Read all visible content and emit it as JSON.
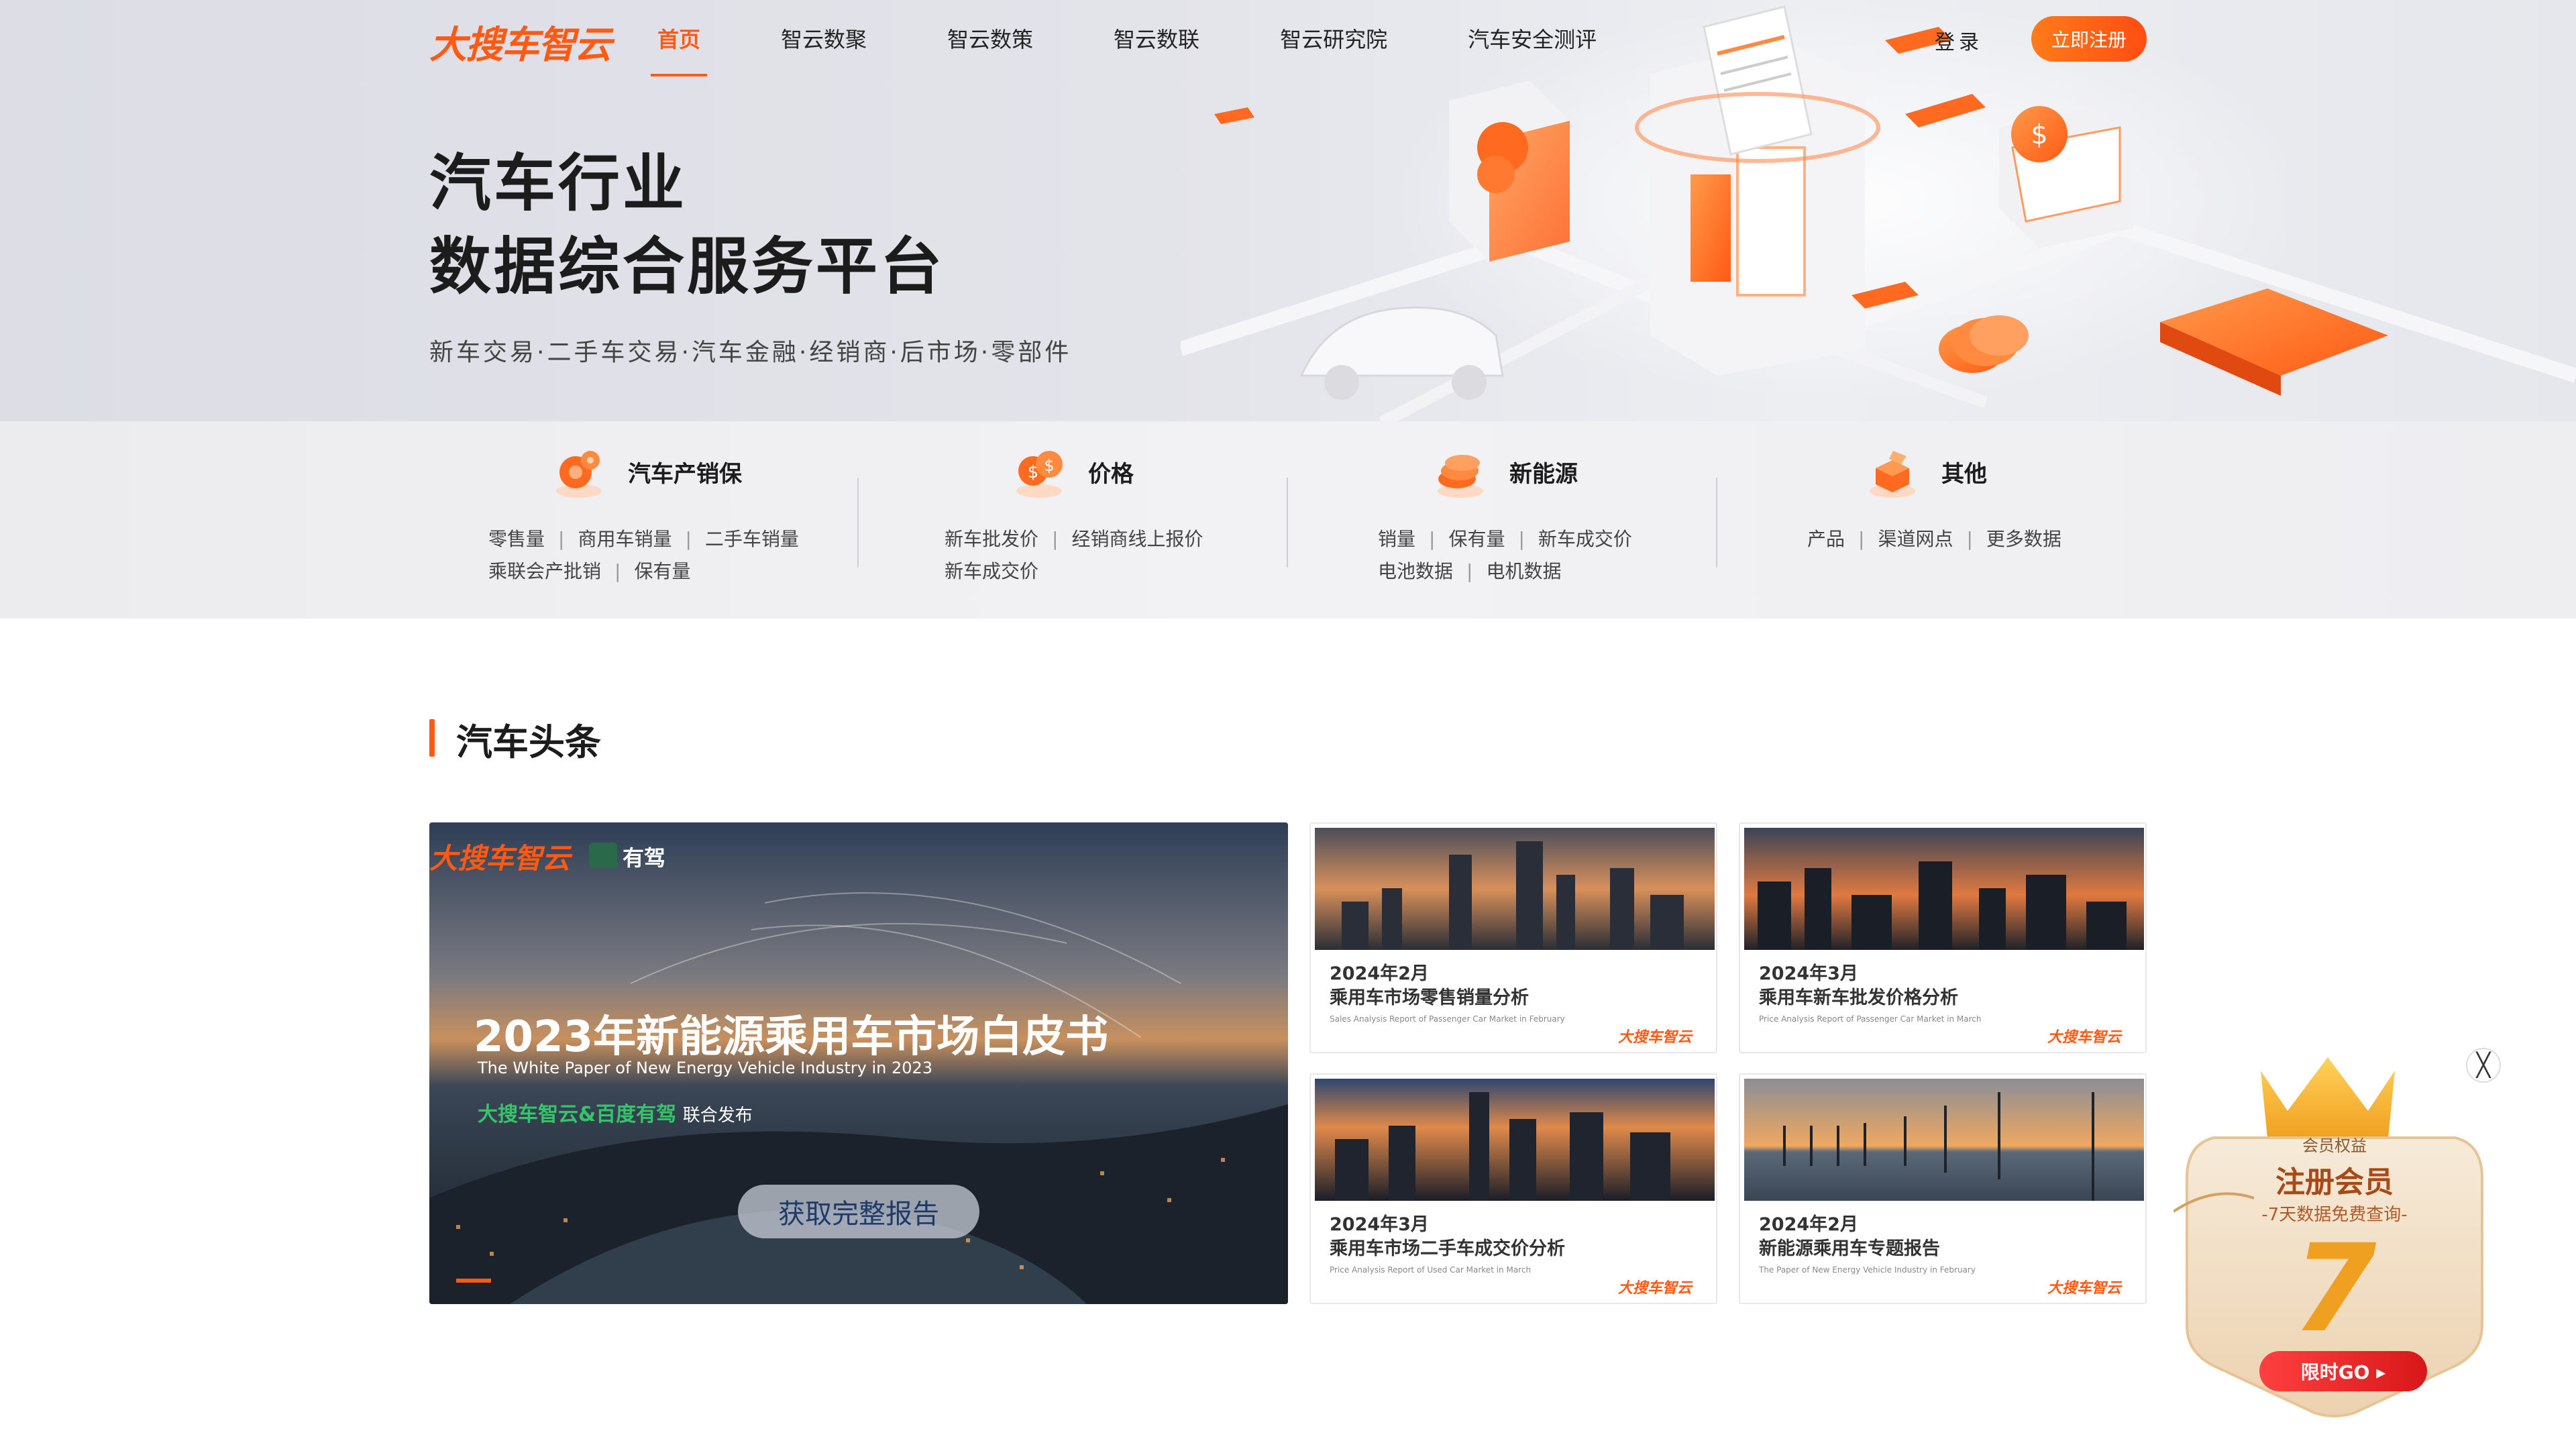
{
  "header": {
    "logo": "大搜车智云",
    "nav": [
      "首页",
      "智云数聚",
      "智云数策",
      "智云数联",
      "智云研究院",
      "汽车安全测评"
    ],
    "login": "登录",
    "register": "立即注册"
  },
  "hero": {
    "title_line1": "汽车行业",
    "title_line2": "数据综合服务平台",
    "subtitle": "新车交易·二手车交易·汽车金融·经销商·后市场·零部件"
  },
  "categories": [
    {
      "title": "汽车产销保",
      "line1": [
        "零售量",
        "商用车销量",
        "二手车销量"
      ],
      "line2": [
        "乘联会产批销",
        "保有量"
      ]
    },
    {
      "title": "价格",
      "line1": [
        "新车批发价",
        "经销商线上报价"
      ],
      "line2": [
        "新车成交价"
      ]
    },
    {
      "title": "新能源",
      "line1": [
        "销量",
        "保有量",
        "新车成交价"
      ],
      "line2": [
        "电池数据",
        "电机数据"
      ]
    },
    {
      "title": "其他",
      "line1": [
        "产品",
        "渠道网点",
        "更多数据"
      ],
      "line2": []
    }
  ],
  "section": {
    "title": "汽车头条"
  },
  "featured": {
    "brand1": "大搜车智云",
    "brand2": "有驾",
    "title": "2023年新能源乘用车市场白皮书",
    "subtitle_en": "The White Paper of New Energy Vehicle Industry in 2023",
    "publisher": "大搜车智云&百度有驾",
    "publisher_suffix": "联合发布",
    "button": "获取完整报告"
  },
  "reports": [
    {
      "date": "2024年2月",
      "title": "乘用车市场零售销量分析",
      "sub": "Sales Analysis Report of Passenger  Car Market  in February",
      "brand": "大搜车智云"
    },
    {
      "date": "2024年3月",
      "title": "乘用车新车批发价格分析",
      "sub": "Price Analysis Report of Passenger  Car Market  in March",
      "brand": "大搜车智云"
    },
    {
      "date": "2024年3月",
      "title": "乘用车市场二手车成交价分析",
      "sub": "Price Analysis Report of Used  Car Market  in March",
      "brand": "大搜车智云"
    },
    {
      "date": "2024年2月",
      "title": "新能源乘用车专题报告",
      "sub": "The Paper of New Energy Vehicle Industry in February",
      "brand": "大搜车智云"
    }
  ],
  "promo": {
    "tag": "会员权益",
    "title": "注册会员",
    "sub": "-7天数据免费查询-",
    "number": "7",
    "button": "限时GO ▸",
    "close": "╳"
  },
  "colors": {
    "accent": "#ff5a14",
    "accent_light": "#ff7b1a"
  }
}
